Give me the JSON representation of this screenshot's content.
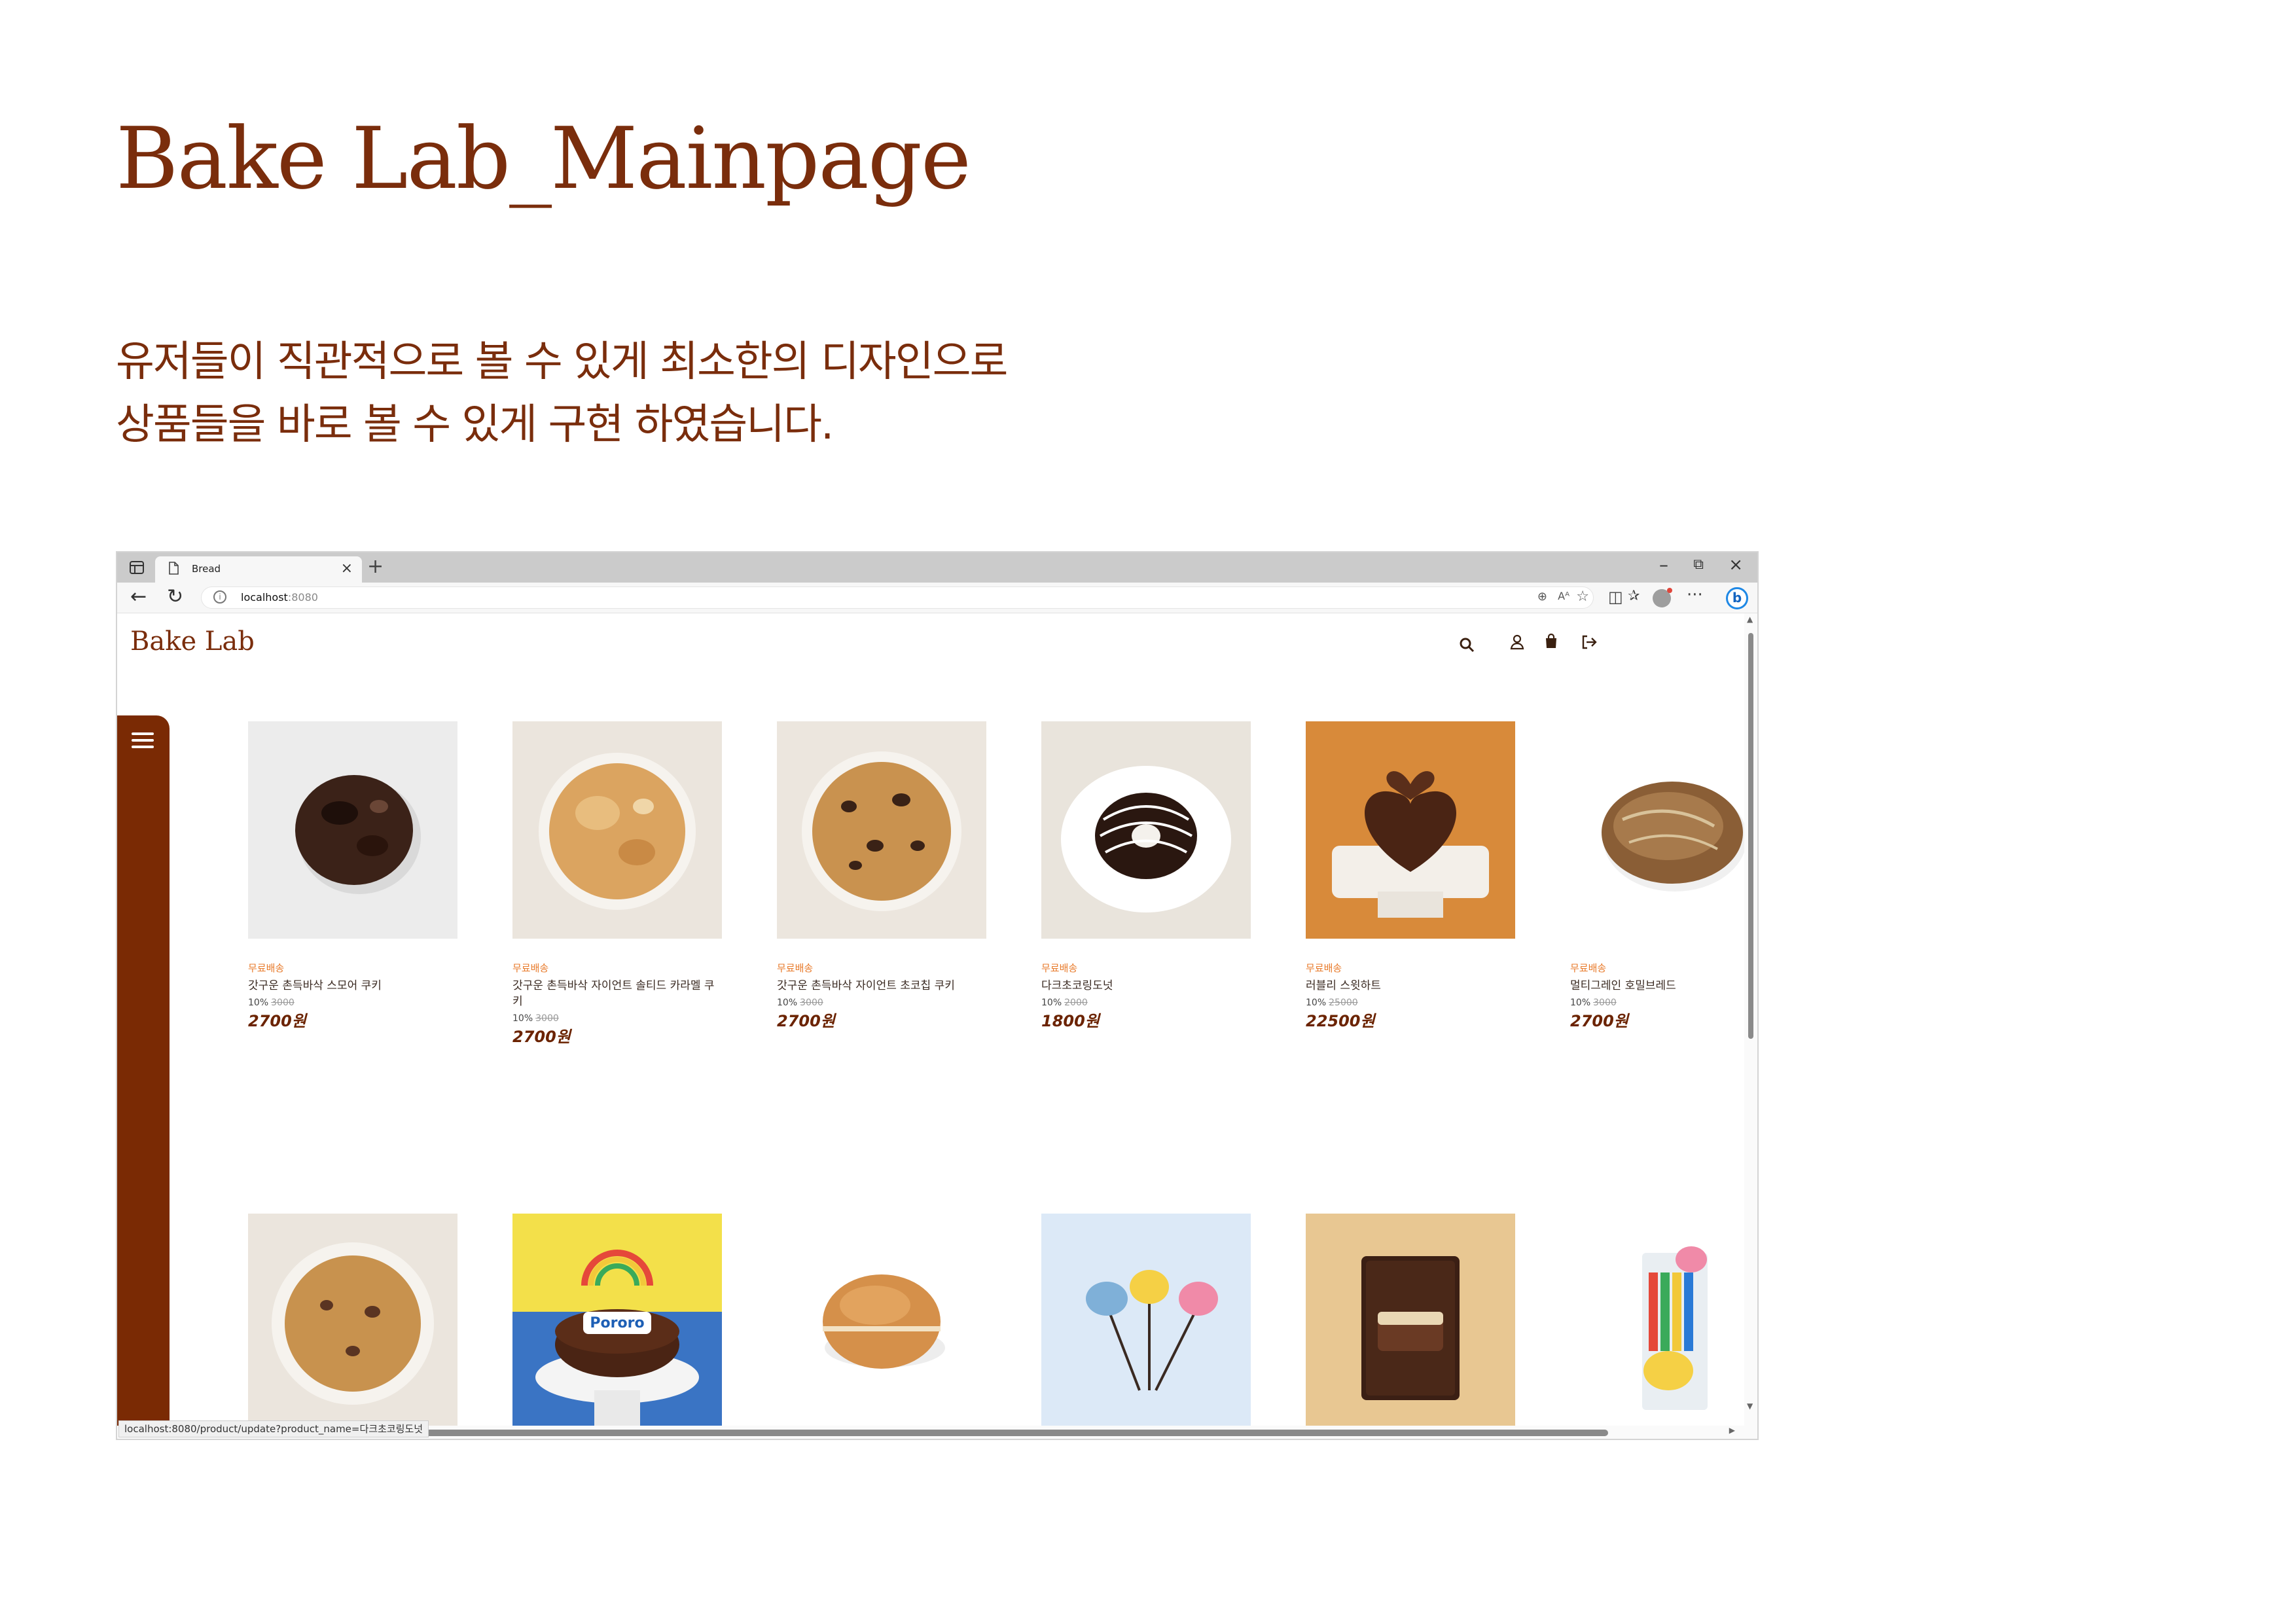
{
  "doc": {
    "title": "Bake Lab_Mainpage",
    "desc_line1": "유저들이 직관적으로 볼 수 있게 최소한의 디자인으로",
    "desc_line2": "상품들을 바로 볼 수 있게 구현 하였습니다."
  },
  "browser": {
    "tab_title": "Bread",
    "url_host": "localhost",
    "url_port": ":8080",
    "status_url": "localhost:8080/product/update?product_name=다크초코링도넛"
  },
  "site": {
    "logo": "Bake Lab",
    "icons": [
      "search-icon",
      "user-icon",
      "shopping-bag-icon",
      "logout-icon"
    ]
  },
  "products": [
    {
      "badge": "무료배송",
      "name": "갓구운 촌득바삭 스모어 쿠키",
      "discount": "10%",
      "original": "3000",
      "price": "2700원"
    },
    {
      "badge": "무료배송",
      "name": "갓구운 촌득바삭 자이언트 솔티드 카라멜 쿠키",
      "discount": "10%",
      "original": "3000",
      "price": "2700원"
    },
    {
      "badge": "무료배송",
      "name": "갓구운 촌득바삭 자이언트 초코칩 쿠키",
      "discount": "10%",
      "original": "3000",
      "price": "2700원"
    },
    {
      "badge": "무료배송",
      "name": "다크초코링도넛",
      "discount": "10%",
      "original": "2000",
      "price": "1800원"
    },
    {
      "badge": "무료배송",
      "name": "러블리 스윗하트",
      "discount": "10%",
      "original": "25000",
      "price": "22500원"
    },
    {
      "badge": "무료배송",
      "name": "멀티그레인 호밀브레드",
      "discount": "10%",
      "original": "3000",
      "price": "2700원"
    }
  ],
  "colors": {
    "brand": "#7a2d0c",
    "sidebar": "#7a2a04",
    "badge": "#e87a2a",
    "price": "#6b2300"
  }
}
